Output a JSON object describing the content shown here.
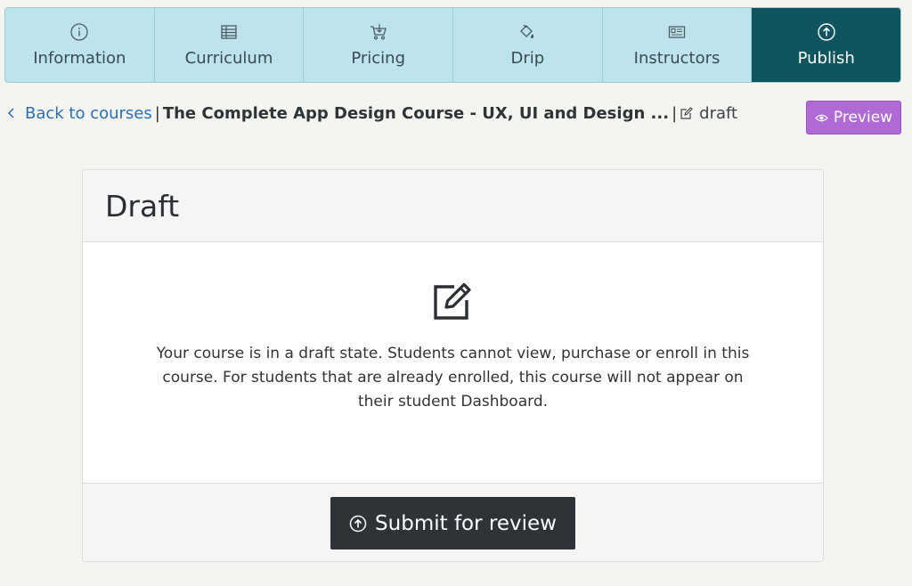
{
  "tabs": [
    {
      "label": "Information",
      "icon": "info-circle-icon"
    },
    {
      "label": "Curriculum",
      "icon": "table-icon"
    },
    {
      "label": "Pricing",
      "icon": "cart-icon"
    },
    {
      "label": "Drip",
      "icon": "paint-bucket-icon"
    },
    {
      "label": "Instructors",
      "icon": "id-card-icon"
    },
    {
      "label": "Publish",
      "icon": "upload-circle-icon",
      "active": true
    }
  ],
  "breadcrumb": {
    "back_label": "Back to courses",
    "separator": "|",
    "course_title": "The Complete App Design Course - UX, UI and Design ...",
    "status_label": "draft"
  },
  "preview_button": {
    "label": "Preview"
  },
  "card": {
    "title": "Draft",
    "message": "Your course is in a draft state. Students cannot view, purchase or enroll in this course. For students that are already enrolled, this course will not appear on their student Dashboard.",
    "submit_label": "Submit for review"
  },
  "colors": {
    "tab_background": "#bde4ec",
    "tab_active": "#0f5560",
    "link": "#2a6fb0",
    "preview_button": "#b06ad6",
    "submit_button": "#2e3338",
    "page_background": "#f4f4f1"
  }
}
